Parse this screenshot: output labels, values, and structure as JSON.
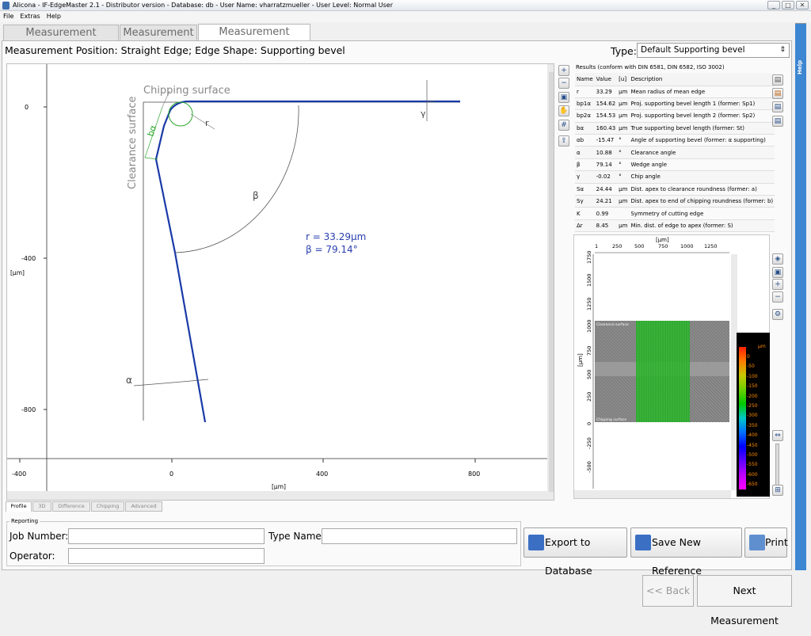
{
  "window": {
    "title": "Alicona - IF-EdgeMaster 2.1 - Distributor version - Database: db - User Name: vharratzmueller - User Level: Normal User",
    "controls": [
      "_",
      "□",
      "✕"
    ]
  },
  "menu": [
    "File",
    "Extras",
    "Help"
  ],
  "tabs": [
    {
      "label": "Measurement Settings",
      "active": false
    },
    {
      "label": "Measurement",
      "active": false
    },
    {
      "label": "Measurement Results",
      "active": true
    }
  ],
  "measurement_position": "Measurement Position: Straight Edge; Edge Shape: Supporting bevel",
  "type": {
    "label": "Type:",
    "value": "Default Supporting bevel"
  },
  "profile_plot": {
    "x_unit": "[μm]",
    "y_unit": "[μm]",
    "x_ticks": [
      "-400",
      "0",
      "400",
      "800"
    ],
    "y_ticks": [
      "0",
      "-400",
      "-800"
    ],
    "annotations": {
      "chipping": "Chipping surface",
      "clearance": "Clearance surface",
      "b_alpha": "bα",
      "r": "r",
      "gamma": "γ",
      "beta": "β",
      "alpha": "α",
      "info_r": "r = 33.29μm",
      "info_beta": "β = 79.14°"
    },
    "colors": {
      "profile": "#1a3aa8",
      "annotation": "#666666",
      "circle": "#2ea82e",
      "info": "#2a3fb0"
    }
  },
  "plot_tools": [
    "zoom-in-icon",
    "zoom-out-icon",
    "fit-icon",
    "pan-icon",
    "grid-icon",
    "export-icon"
  ],
  "results": {
    "title": "Results (conform with DIN 6581, DIN 6582, ISO 3002)",
    "headers": [
      "Name",
      "Value",
      "[u]",
      "Description"
    ],
    "rows": [
      [
        "r",
        "33.29",
        "μm",
        "Mean radius of mean edge"
      ],
      [
        "bp1α",
        "154.62",
        "μm",
        "Proj. supporting bevel length 1 (former: Sp1)"
      ],
      [
        "bp2α",
        "154.53",
        "μm",
        "Proj. supporting bevel length 2 (former: Sp2)"
      ],
      [
        "bα",
        "160.43",
        "μm",
        "True supporting bevel length (former: St)"
      ],
      [
        "αb",
        "-15.47",
        "°",
        "Angle of supporting bevel (former: α supporting)"
      ],
      [
        "α",
        "10.88",
        "°",
        "Clearance angle"
      ],
      [
        "β",
        "79.14",
        "°",
        "Wedge angle"
      ],
      [
        "γ",
        "-0.02",
        "°",
        "Chip angle"
      ],
      [
        "Sα",
        "24.44",
        "μm",
        "Dist. apex to clearance roundness (former: a)"
      ],
      [
        "Sγ",
        "24.21",
        "μm",
        "Dist. apex to end of chipping roundness (former: b)"
      ],
      [
        "K",
        "0.99",
        "",
        "Symmetry of cutting edge"
      ],
      [
        "Δr",
        "8.45",
        "μm",
        "Min. dist. of edge to apex (former: S)"
      ]
    ]
  },
  "image_view": {
    "x_unit": "[μm]",
    "y_unit": "[μm]",
    "x_ticks": [
      "1",
      "250",
      "500",
      "750",
      "1000",
      "1250"
    ],
    "y_ticks": [
      "1750",
      "1500",
      "1250",
      "1000",
      "750",
      "500",
      "250",
      "0",
      "-250",
      "-500"
    ],
    "label_top": "Clearance surface",
    "label_bottom": "Chipping surface"
  },
  "colorbar": {
    "unit": "μm",
    "labels": [
      "0",
      "-50",
      "-100",
      "-150",
      "-200",
      "-250",
      "-300",
      "-350",
      "-400",
      "-450",
      "-500",
      "-550",
      "-600",
      "-650"
    ]
  },
  "bottom_tabs": [
    {
      "label": "Profile",
      "active": true
    },
    {
      "label": "3D",
      "active": false
    },
    {
      "label": "Difference",
      "active": false
    },
    {
      "label": "Chipping",
      "active": false
    },
    {
      "label": "Advanced",
      "active": false
    }
  ],
  "reporting": {
    "title": "Reporting",
    "job_number_label": "Job Number:",
    "job_number_value": "",
    "type_name_label": "Type Name:",
    "type_name_value": "",
    "operator_label": "Operator:",
    "operator_value": ""
  },
  "buttons": {
    "export": "Export to Database",
    "save_ref": "Save New Reference",
    "print": "Print",
    "back": "<< Back",
    "next": "Next Measurement"
  },
  "help": {
    "label": "Help",
    "arrow": "»"
  }
}
